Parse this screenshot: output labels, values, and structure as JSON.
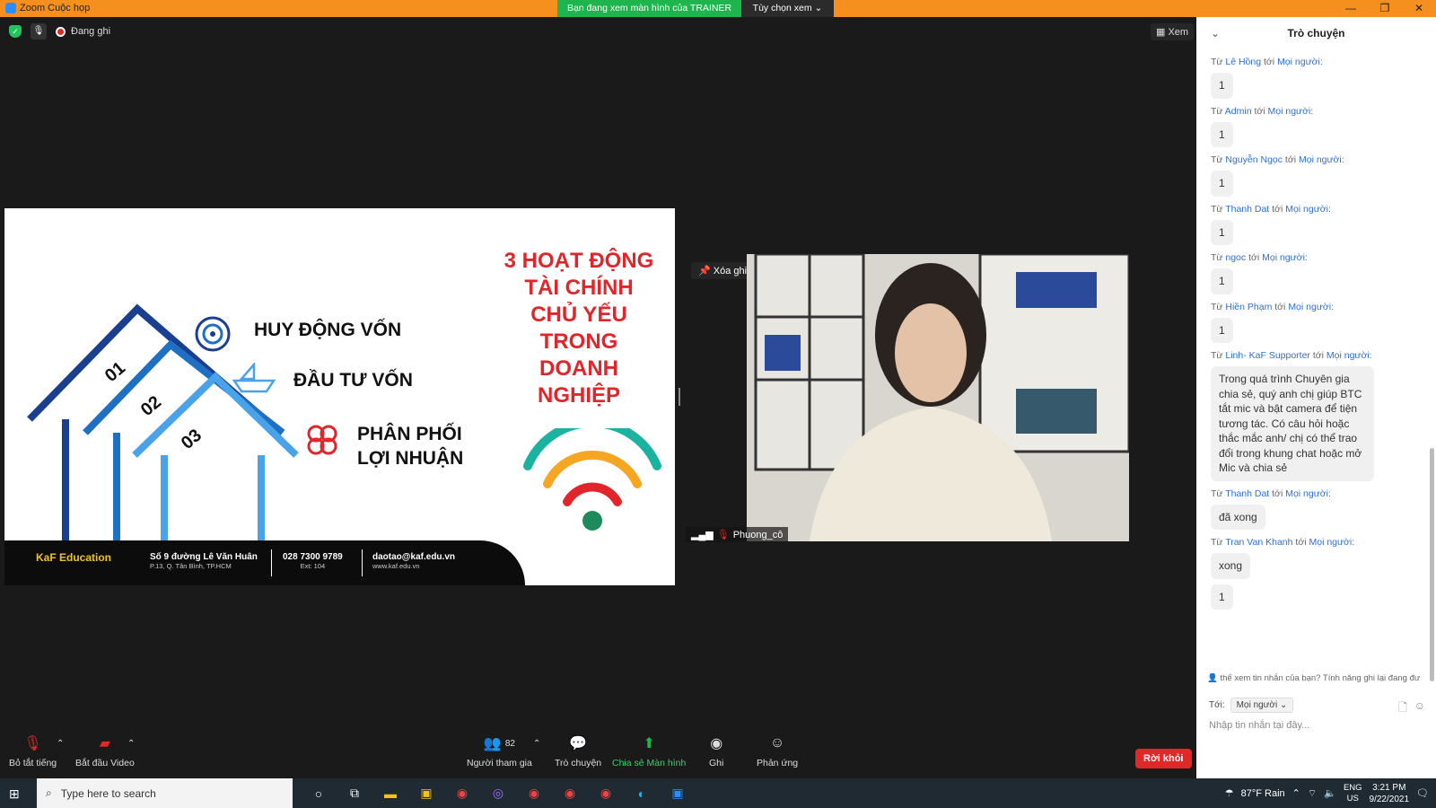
{
  "titlebar": {
    "app_title": "Zoom Cuộc họp",
    "banner": "Bạn đang xem màn hình của TRAINER",
    "view_options": "Tùy chọn xem ⌄",
    "minimize": "—",
    "restore": "❐",
    "close": "✕"
  },
  "status": {
    "recording": "Đang ghi",
    "view": "Xem"
  },
  "slide": {
    "title_lines": [
      "3 HOẠT ĐỘNG",
      "TÀI CHÍNH",
      "CHỦ YẾU",
      "TRONG",
      "DOANH",
      "NGHIỆP"
    ],
    "item1": "HUY ĐỘNG VỐN",
    "item2": "ĐẦU TƯ VỐN",
    "item3_line1": "PHÂN PHỐI",
    "item3_line2": "LỢI NHUẬN",
    "num1": "01",
    "num2": "02",
    "num3": "03",
    "footer": {
      "logo": "KaF Education",
      "address": "Số 9 đường Lê Văn Huân",
      "address_sub": "P.13, Q. Tân Bình, TP.HCM",
      "phone": "028 7300 9789",
      "phone_sub": "Ext: 104",
      "email": "daotao@kaf.edu.vn",
      "web": "www.kaf.edu.vn"
    }
  },
  "video": {
    "unpin": "Xóa ghim",
    "participant_name": "Phuong_cô"
  },
  "toolbar": {
    "mute": "Bỏ tắt tiếng",
    "start_video": "Bắt đầu Video",
    "participants": "Người tham gia",
    "participants_count": "82",
    "chat": "Trò chuyện",
    "share": "Chia sẻ Màn hình",
    "record": "Ghi",
    "reactions": "Phản ứng",
    "leave": "Rời khỏi"
  },
  "chat": {
    "title": "Trò chuyện",
    "from_prefix": "Từ",
    "to_word": "tới",
    "everyone": "Mọi người:",
    "messages": [
      {
        "sender": "Lê Hồng",
        "text": "1"
      },
      {
        "sender": "Admin",
        "text": "1"
      },
      {
        "sender": "Nguyễn Ngọc",
        "text": "1"
      },
      {
        "sender": "Thanh Dat",
        "text": "1"
      },
      {
        "sender": "ngoc",
        "text": "1"
      },
      {
        "sender": "Hiền Phạm",
        "text": "1"
      },
      {
        "sender": "Linh- KaF Supporter",
        "text": "Trong quá trình Chuyên gia chia sẻ, quý anh chị giúp BTC tắt mic và bật camera để tiện tương tác. Có câu hỏi hoặc thắc mắc anh/ chị có thể trao đổi trong khung chat hoặc mở Mic và chia sẻ"
      },
      {
        "sender": "Thanh Dat",
        "text": "đã xong"
      },
      {
        "sender": "Tran Van Khanh",
        "text": "xong",
        "text2": "1"
      }
    ],
    "notice": "thể xem tin nhắn của bạn? Tính năng ghi lại đang đư",
    "to_label": "Tới:",
    "to_value": "Mọi người ⌄",
    "input_placeholder": "Nhập tin nhắn tại đây..."
  },
  "taskbar": {
    "search_placeholder": "Type here to search",
    "weather": "87°F  Rain",
    "lang1": "ENG",
    "lang2": "US",
    "time": "3:21 PM",
    "date": "9/22/2021"
  }
}
